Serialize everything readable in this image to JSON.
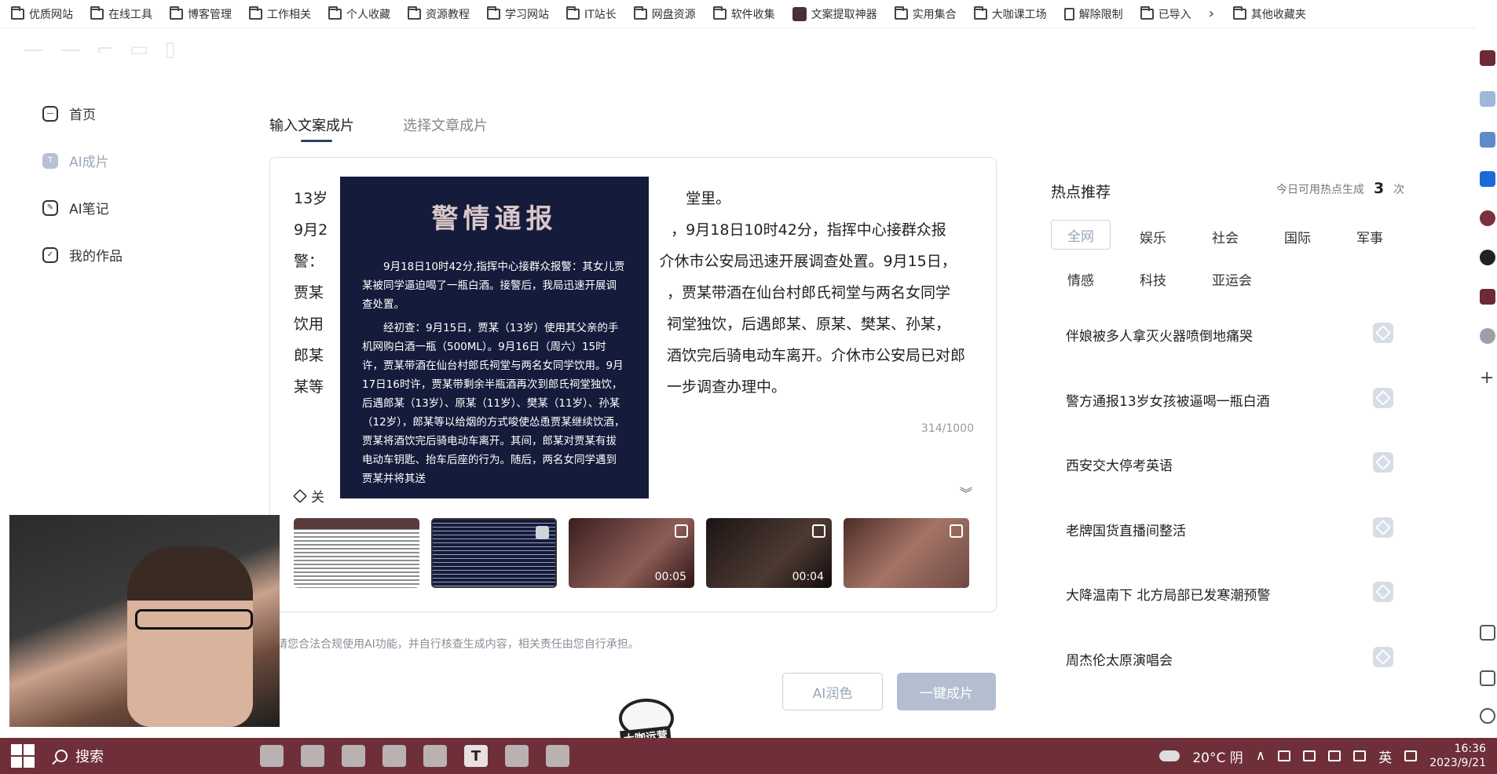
{
  "bookmarks": {
    "items": [
      {
        "label": "优质网站",
        "icon": "folder-icon"
      },
      {
        "label": "在线工具",
        "icon": "folder-icon"
      },
      {
        "label": "博客管理",
        "icon": "folder-icon"
      },
      {
        "label": "工作相关",
        "icon": "folder-icon"
      },
      {
        "label": "个人收藏",
        "icon": "folder-icon"
      },
      {
        "label": "资源教程",
        "icon": "folder-icon"
      },
      {
        "label": "学习网站",
        "icon": "folder-icon"
      },
      {
        "label": "IT站长",
        "icon": "folder-icon"
      },
      {
        "label": "网盘资源",
        "icon": "folder-icon"
      },
      {
        "label": "软件收集",
        "icon": "folder-icon"
      },
      {
        "label": "文案提取神器",
        "icon": "app-icon"
      },
      {
        "label": "实用集合",
        "icon": "folder-icon"
      },
      {
        "label": "大咖课工场",
        "icon": "folder-icon"
      },
      {
        "label": "解除限制",
        "icon": "page-icon"
      },
      {
        "label": "已导入",
        "icon": "folder-icon"
      }
    ],
    "overflow_icon": "chevron-right-icon",
    "other_label": "其他收藏夹"
  },
  "nav": {
    "home": "首页",
    "ai_film": "AI成片",
    "ai_notes": "AI笔记",
    "my_works": "我的作品"
  },
  "tabs": {
    "active": "输入文案成片",
    "inactive": "选择文章成片"
  },
  "editor": {
    "lines": [
      "13岁　　　　　　　　　　　　　　　　　　　　　　　　堂里。",
      "9月2　　　　　　　　　　　　　　　　　　　　　　　，9月18日10时42分，指挥中心接群众报",
      "警：　　　　　　　　　　　　　　　　　　　　　　　介休市公安局迅速开展调查处置。9月15日，",
      "贾某　　　　　　　　　　　　　　　　　　　　　　　，贾某带酒在仙台村郎氏祠堂与两名女同学",
      "饮用　　　　　　　　　　　　　　　　　　　　　　　祠堂独饮，后遇郎某、原某、樊某、孙某，",
      "郎某　　　　　　　　　　　　　　　　　　　　　　　酒饮完后骑电动车离开。介休市公安局已对郎",
      "某等　　　　　　　　　　　　　　　　　　　　　　　一步调查办理中。"
    ],
    "counter": "314/1000",
    "related_label": "关",
    "expand_icon": "chevron-double-down-icon"
  },
  "notice": {
    "title": "警情通报",
    "paragraphs": [
      "9月18日10时42分,指挥中心接群众报警：其女儿贾某被同学逼迫喝了一瓶白酒。接警后，我局迅速开展调查处置。",
      "经初查：9月15日，贾某（13岁）使用其父亲的手机网购白酒一瓶（500ML）。9月16日（周六）15时许，贾某带酒在仙台村郎氏祠堂与两名女同学饮用。9月17日16时许，贾某带剩余半瓶酒再次到郎氏祠堂独饮，后遇郎某（13岁）、原某（11岁）、樊某（11岁）、孙某（12岁），郎某等以给烟的方式唆使怂恿贾某继续饮酒，贾某将酒饮完后骑电动车离开。其间，郎某对贾某有拔电动车钥匙、抬车后座的行为。随后，两名女同学遇到贾某并将其送"
    ]
  },
  "thumbnails": [
    {
      "kind": "doc",
      "checked": false,
      "duration": ""
    },
    {
      "kind": "dark",
      "checked": true,
      "duration": ""
    },
    {
      "kind": "video1",
      "checked": false,
      "duration": "00:05"
    },
    {
      "kind": "video2",
      "checked": false,
      "duration": "00:04"
    },
    {
      "kind": "video3",
      "checked": false,
      "duration": ""
    }
  ],
  "disclaimer": "请您合法合规使用AI功能，并自行核查生成内容，相关责任由您自行承担。",
  "buttons": {
    "polish": "AI润色",
    "generate": "一键成片"
  },
  "hot": {
    "title": "热点推荐",
    "quota_prefix": "今日可用热点生成",
    "quota_count": "3",
    "quota_suffix": "次",
    "categories": [
      "全网",
      "娱乐",
      "社会",
      "国际",
      "军事",
      "情感",
      "科技",
      "亚运会"
    ],
    "items": [
      "伴娘被多人拿灭火器喷倒地痛哭",
      "警方通报13岁女孩被逼喝一瓶白酒",
      "西安交大停考英语",
      "老牌国货直播间整活",
      "大降温南下 北方局部已发寒潮预警",
      "周杰伦太原演唱会"
    ]
  },
  "watermark": "大咖运营",
  "taskbar": {
    "search_label": "搜索",
    "app_t_label": "T",
    "weather": "20°C 阴",
    "ime": "英",
    "time": "16:36",
    "date": "2023/9/21"
  },
  "colors": {
    "accent_dark": "#2c3e63",
    "muted_blue": "#9aa6b8",
    "taskbar": "#6e2f39",
    "notice_bg": "#141b3b"
  }
}
